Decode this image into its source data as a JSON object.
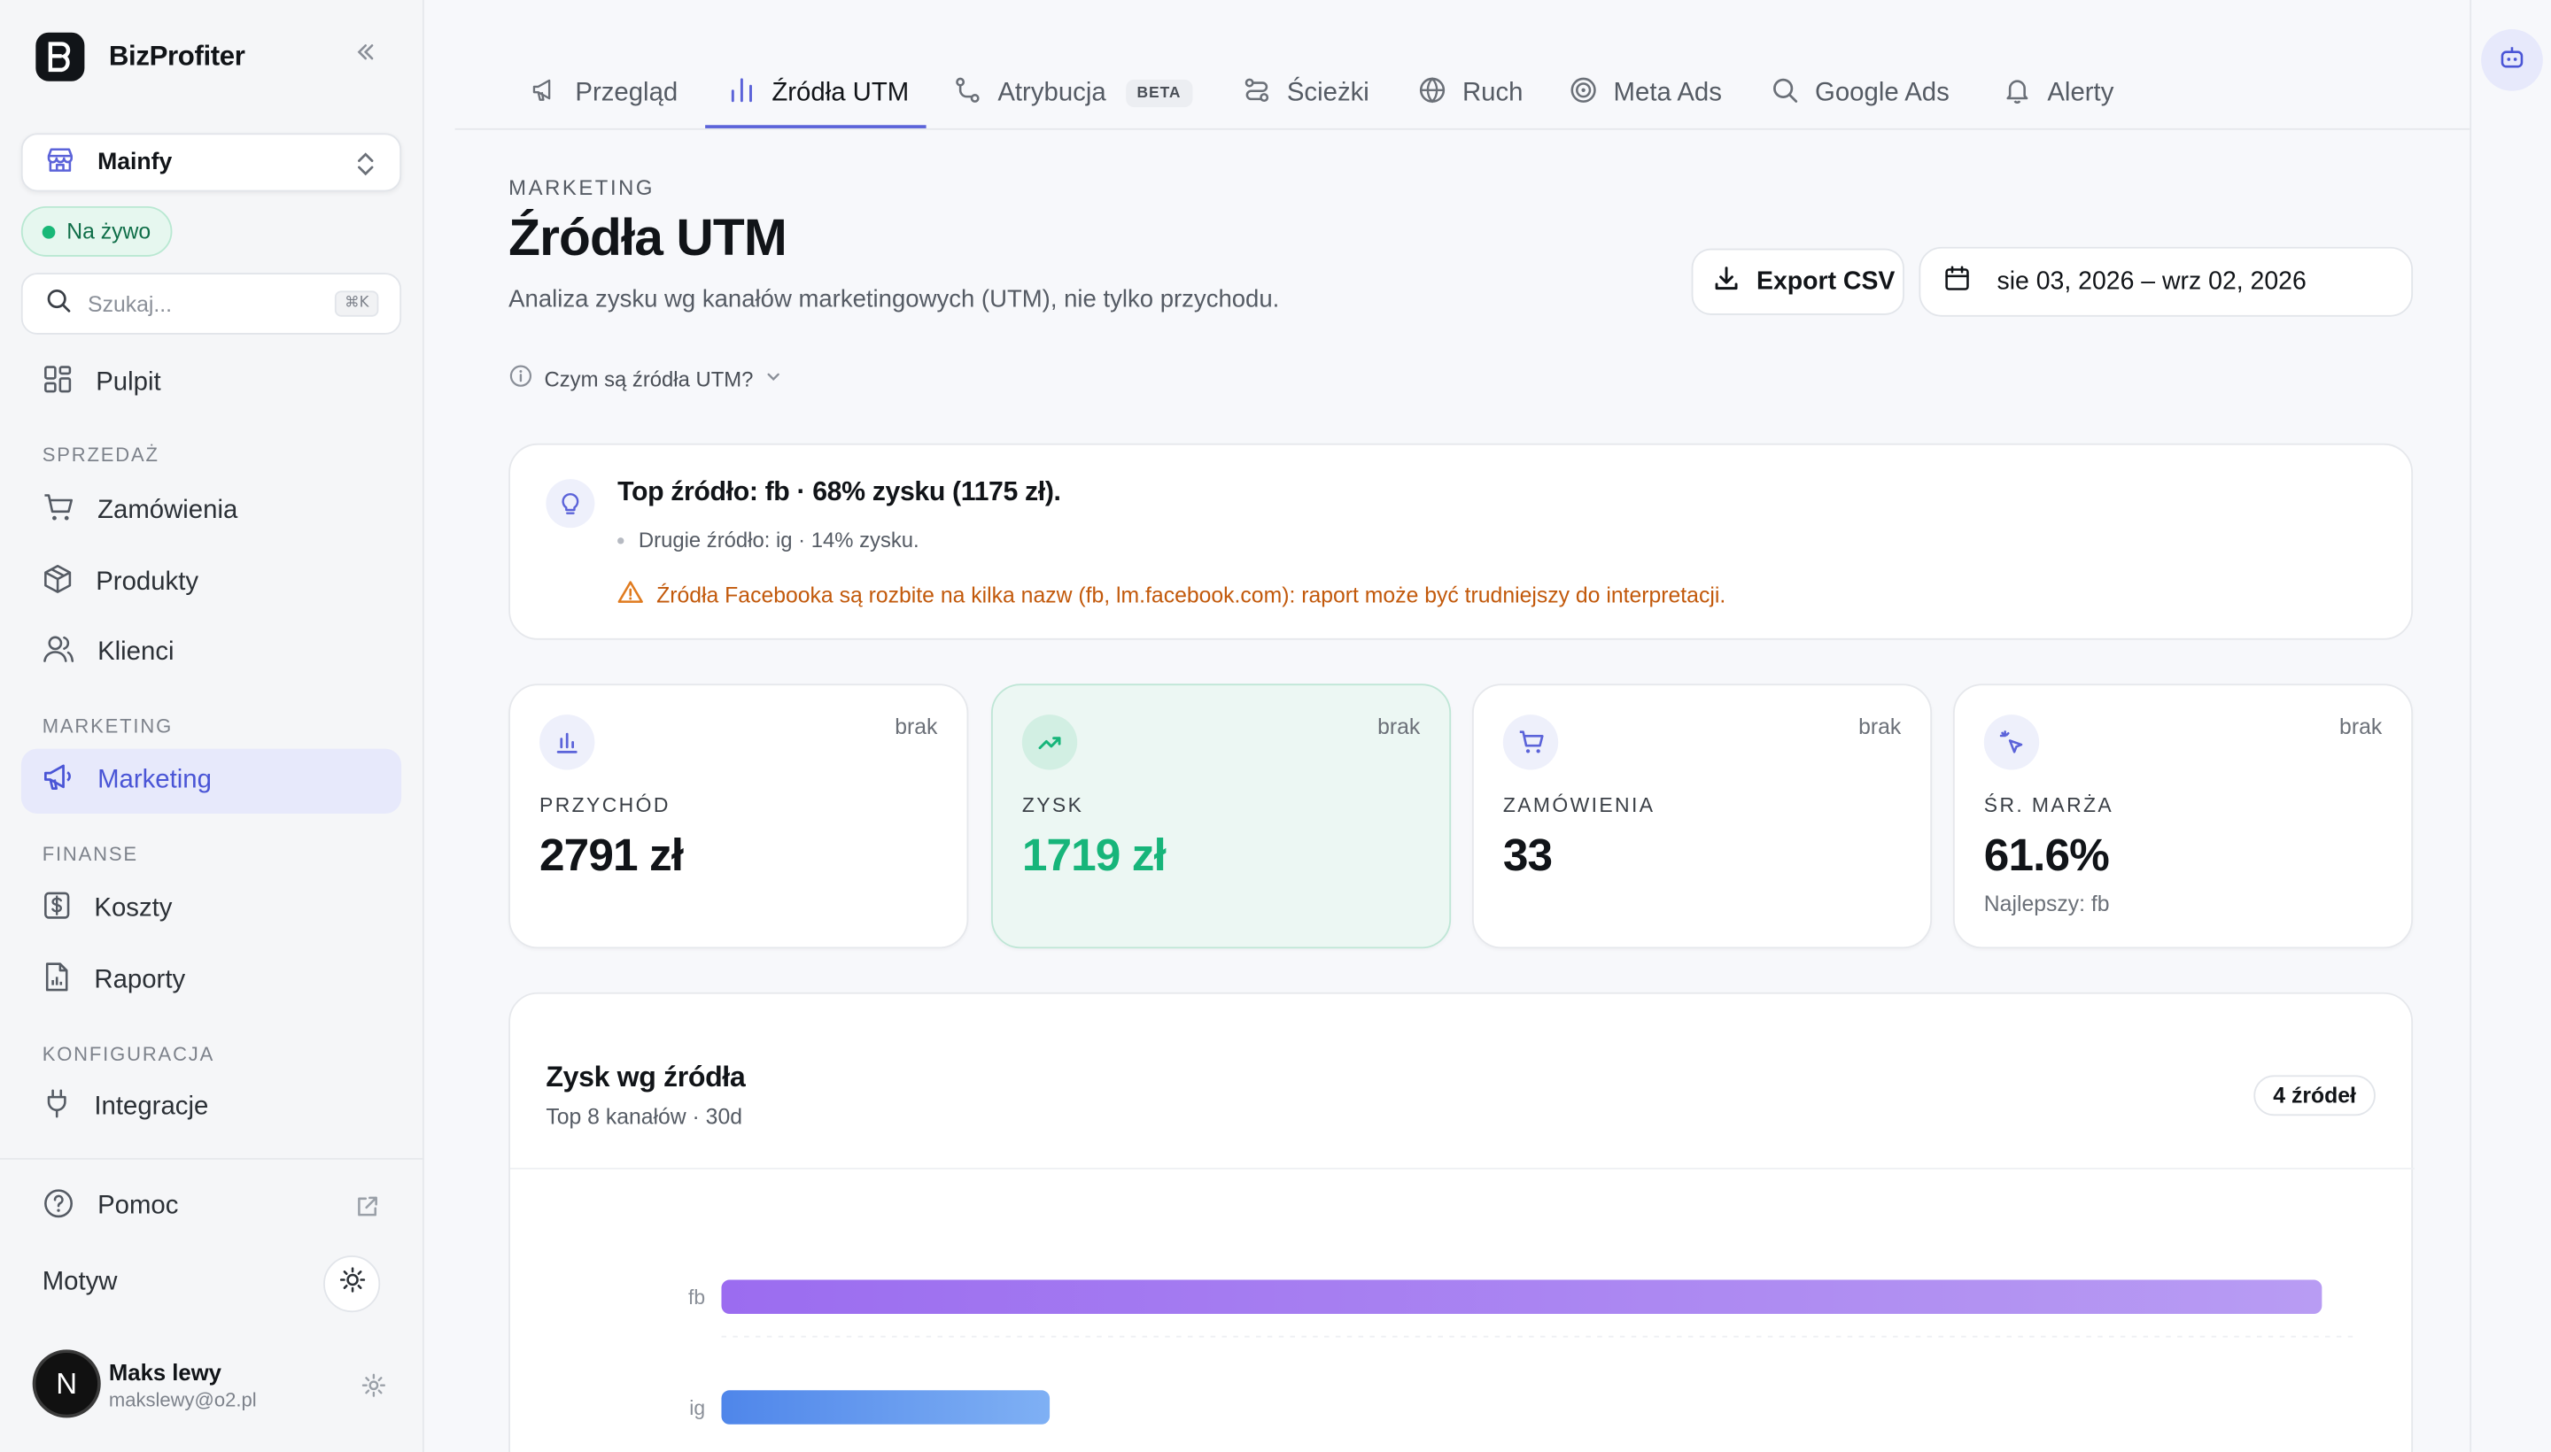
{
  "app": {
    "name": "BizProfiter"
  },
  "sidebar": {
    "store": "Mainfy",
    "live_label": "Na żywo",
    "search_placeholder": "Szukaj...",
    "search_shortcut": "⌘K",
    "pulpit": "Pulpit",
    "sections": {
      "sales": "SPRZEDAŻ",
      "marketing": "MARKETING",
      "finance": "FINANSE",
      "config": "KONFIGURACJA"
    },
    "items": {
      "orders": "Zamówienia",
      "products": "Produkty",
      "clients": "Klienci",
      "marketing": "Marketing",
      "costs": "Koszty",
      "reports": "Raporty",
      "integrations": "Integracje"
    },
    "help": "Pomoc",
    "theme": "Motyw",
    "user": {
      "initial": "N",
      "name": "Maks lewy",
      "email": "makslewy@o2.pl"
    }
  },
  "tabs": {
    "overview": "Przegląd",
    "utm": "Źródła UTM",
    "attribution": "Atrybucja",
    "beta": "BETA",
    "paths": "Ścieżki",
    "traffic": "Ruch",
    "meta": "Meta Ads",
    "google": "Google Ads",
    "alerts": "Alerty"
  },
  "header": {
    "eyebrow": "MARKETING",
    "title": "Źródła UTM",
    "subtitle": "Analiza zysku wg kanałów marketingowych (UTM), nie tylko przychodu.",
    "help": "Czym są źródła UTM?",
    "export": "Export CSV",
    "date_range": "sie 03, 2026 – wrz 02, 2026"
  },
  "insight": {
    "title": "Top źródło: fb · 68% zysku (1175 zł).",
    "secondary": "Drugie źródło: ig · 14% zysku.",
    "warning": "Źródła Facebooka są rozbite na kilka nazw (fb, lm.facebook.com): raport może być trudniejszy do interpretacji."
  },
  "kpis": {
    "revenue": {
      "label": "PRZYCHÓD",
      "value": "2791 zł",
      "badge": "brak"
    },
    "profit": {
      "label": "ZYSK",
      "value": "1719 zł",
      "badge": "brak"
    },
    "orders": {
      "label": "ZAMÓWIENIA",
      "value": "33",
      "badge": "brak"
    },
    "margin": {
      "label": "ŚR. MARŻA",
      "value": "61.6%",
      "badge": "brak",
      "note": "Najlepszy: fb"
    }
  },
  "chart": {
    "title": "Zysk wg źródła",
    "subtitle": "Top 8 kanałów · 30d",
    "count": "4 źródeł"
  },
  "chart_data": {
    "type": "bar",
    "orientation": "horizontal",
    "categories": [
      "fb",
      "ig"
    ],
    "values": [
      1175,
      241
    ],
    "unit": "zł"
  },
  "colors": {
    "accent": "#5b63d9",
    "profit": "#17b57a",
    "warning": "#c2590b",
    "bar_fb_start": "#9b6cf0",
    "bar_fb_end": "#b89cf3",
    "bar_ig_start": "#4f86ea",
    "bar_ig_end": "#7fb0f4"
  }
}
